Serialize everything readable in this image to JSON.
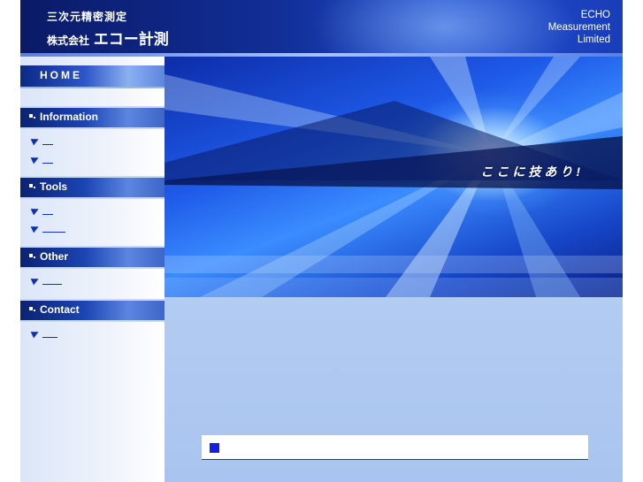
{
  "header": {
    "tagline_top": "三次元精密測定",
    "company_prefix": "株式会社",
    "company_name": "エコー計測",
    "brand": [
      "ECHO",
      "Measurement",
      "Limited"
    ]
  },
  "sidebar": {
    "home_label": "HOME",
    "sections": [
      {
        "label": "Information",
        "link_count": 2
      },
      {
        "label": "Tools",
        "link_count": 2
      },
      {
        "label": "Other",
        "link_count": 1
      },
      {
        "label": "Contact",
        "link_count": 1
      }
    ]
  },
  "hero": {
    "tagline": "ここに技あり!"
  },
  "colors": {
    "accent": "#1620e0",
    "header_dark": "#0a1a66",
    "link_blue": "#1030b0"
  },
  "icons": [
    "arrow-bullet-icon",
    "section-bullet-icon",
    "square-bullet-icon"
  ]
}
